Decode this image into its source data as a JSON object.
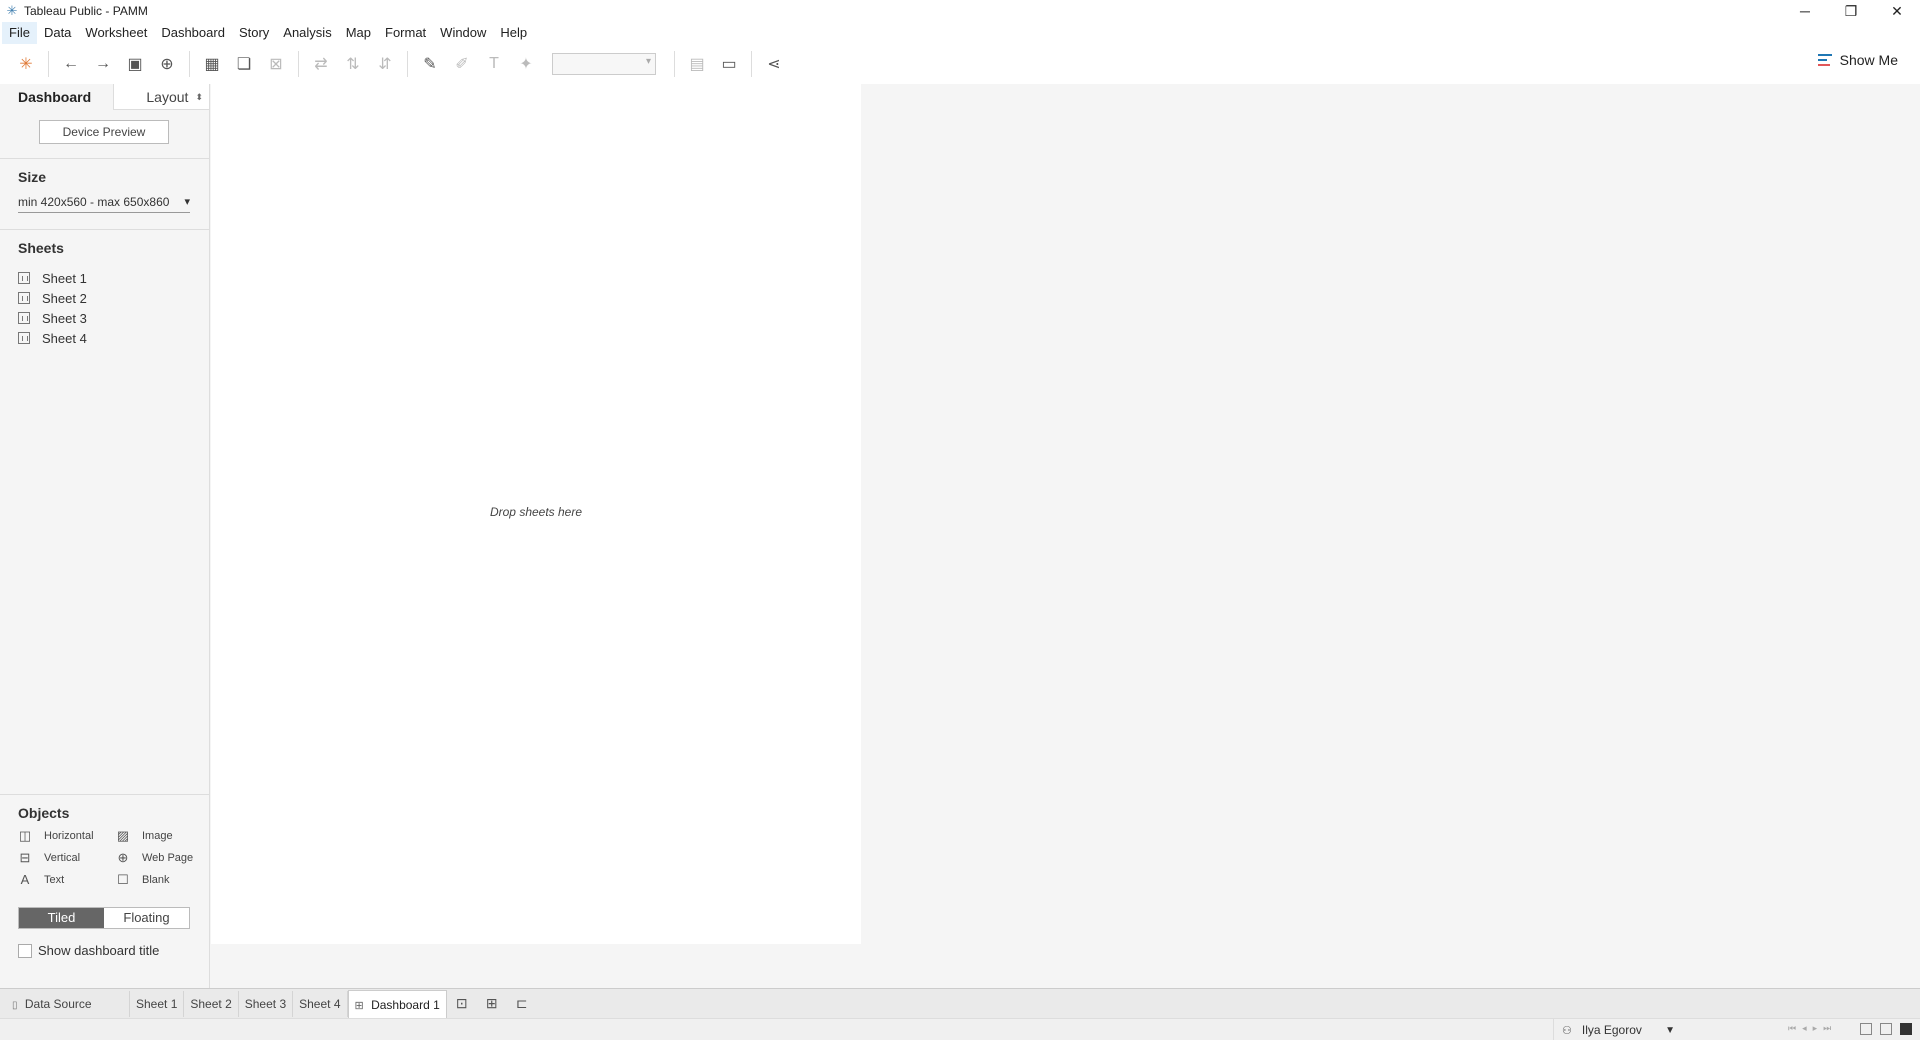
{
  "window": {
    "title": "Tableau Public - PAMM",
    "controls": [
      "minimize-icon",
      "restore-icon",
      "close-icon"
    ]
  },
  "menubar": {
    "items": [
      "File",
      "Data",
      "Worksheet",
      "Dashboard",
      "Story",
      "Analysis",
      "Map",
      "Format",
      "Window",
      "Help"
    ]
  },
  "toolbar": {
    "show_me_label": "Show Me"
  },
  "leftpanel": {
    "tabs": {
      "dashboard": "Dashboard",
      "layout": "Layout"
    },
    "device_preview": "Device Preview",
    "size": {
      "title": "Size",
      "value": "min 420x560 - max 650x860"
    },
    "sheets": {
      "title": "Sheets",
      "items": [
        "Sheet 1",
        "Sheet 2",
        "Sheet 3",
        "Sheet 4"
      ]
    },
    "objects": {
      "title": "Objects",
      "items": [
        "Horizontal",
        "Image",
        "Vertical",
        "Web Page",
        "Text",
        "Blank"
      ]
    },
    "layout_mode": {
      "tiled": "Tiled",
      "floating": "Floating",
      "selected": "Tiled"
    },
    "show_title": {
      "label": "Show dashboard title",
      "checked": false
    }
  },
  "canvas": {
    "drop_hint": "Drop sheets here"
  },
  "tabs": {
    "items": [
      "Data Source",
      "Sheet 1",
      "Sheet 2",
      "Sheet 3",
      "Sheet 4",
      "Dashboard 1"
    ],
    "active": "Dashboard 1"
  },
  "statusbar": {
    "user": "Ilya Egorov"
  },
  "colors": {
    "accent": "#1f77b4",
    "selected_toggle": "#666666"
  }
}
